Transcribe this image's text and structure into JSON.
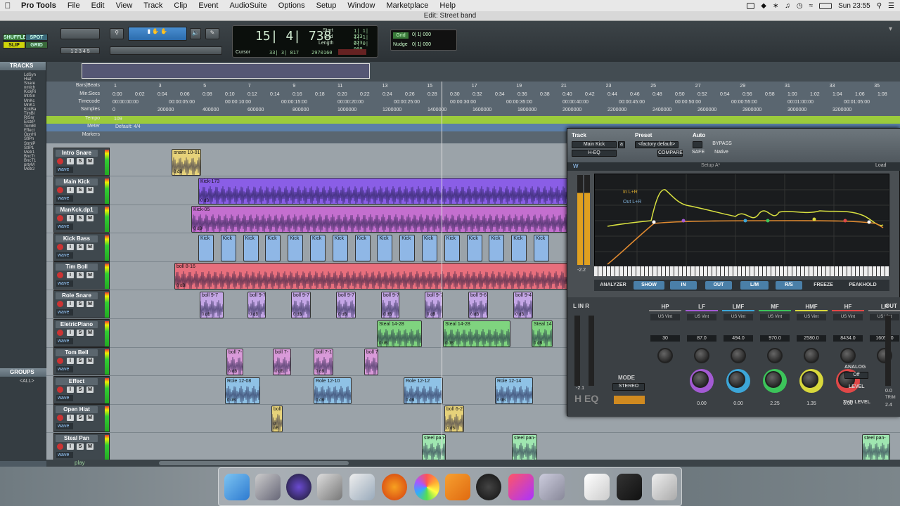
{
  "menubar": {
    "app": "Pro Tools",
    "items": [
      "File",
      "Edit",
      "View",
      "Track",
      "Clip",
      "Event",
      "AudioSuite",
      "Options",
      "Setup",
      "Window",
      "Marketplace",
      "Help"
    ],
    "clock": "Sun 23:55"
  },
  "window_title": "Edit: Street band",
  "toolbar": {
    "modes": [
      "SHUFFLE",
      "SPOT",
      "SLIP",
      "GRID"
    ],
    "counter": {
      "main": "15| 4| 738",
      "start_label": "Start",
      "end_label": "End",
      "length_label": "Length",
      "start": "1| 1| 223",
      "end": "1| 1| 223",
      "length": "0| 0| 000",
      "cursor_label": "Cursor",
      "cursor": "33| 3| 817",
      "samples": "2970160"
    },
    "grid_label": "Grid",
    "grid_value": "0| 1| 000",
    "nudge_label": "Nudge",
    "nudge_value": "0| 1| 000"
  },
  "tracks_panel": {
    "title": "TRACKS",
    "items": [
      "LdSyn",
      "Hiat",
      "Snare",
      "nmich",
      "KickRi",
      "IntrSn",
      "MnKc",
      "MnK1",
      "KckBa",
      "TimBl",
      "RlSnr",
      "ElctrP",
      "TomBl",
      "Effect",
      "OpnHi",
      "StlPn",
      "StrnlP",
      "StlP1",
      "Metr1",
      "BncTr",
      "BncT1",
      "prtyM",
      "Metr2"
    ]
  },
  "groups_panel": {
    "title": "GROUPS",
    "all": "<ALL>"
  },
  "rulers": {
    "labels": [
      "Bars|Beats",
      "Min:Secs",
      "Timecode",
      "Samples",
      "Tempo",
      "Meter",
      "Markers"
    ],
    "bars": [
      "1",
      "3",
      "5",
      "7",
      "9",
      "11",
      "13",
      "15",
      "17",
      "19",
      "21",
      "23",
      "25",
      "27",
      "29",
      "31",
      "33",
      "35"
    ],
    "minsecs": [
      "0:00",
      "0:02",
      "0:04",
      "0:06",
      "0:08",
      "0:10",
      "0:12",
      "0:14",
      "0:16",
      "0:18",
      "0:20",
      "0:22",
      "0:24",
      "0:26",
      "0:28",
      "0:30",
      "0:32",
      "0:34",
      "0:36",
      "0:38",
      "0:40",
      "0:42",
      "0:44",
      "0:46",
      "0:48",
      "0:50",
      "0:52",
      "0:54",
      "0:56",
      "0:58",
      "1:00",
      "1:02",
      "1:04",
      "1:06",
      "1:08",
      "1:10",
      "1:12",
      "1:14"
    ],
    "timecode": [
      "00:00:00:00",
      "00:00:05:00",
      "00:00:10:00",
      "00:00:15:00",
      "00:00:20:00",
      "00:00:25:00",
      "00:00:30:00",
      "00:00:35:00",
      "00:00:40:00",
      "00:00:45:00",
      "00:00:50:00",
      "00:00:55:00",
      "00:01:00:00",
      "00:01:05:00",
      "00:01:10:00",
      "00:01:15:00"
    ],
    "samples": [
      "0",
      "200000",
      "400000",
      "600000",
      "800000",
      "1000000",
      "1200000",
      "1400000",
      "1600000",
      "1800000",
      "2000000",
      "2200000",
      "2400000",
      "2600000",
      "2800000",
      "3000000",
      "3200000"
    ],
    "tempo": "109",
    "meter": "Default: 4/4"
  },
  "tracks": [
    {
      "name": "Intro Snare",
      "clips": [
        {
          "label": "snare 10-01",
          "db": "0 dB"
        }
      ],
      "color": "#e6d27a"
    },
    {
      "name": "Main Kick",
      "clips": [
        {
          "label": "Kick-173",
          "db": "0 dB"
        }
      ],
      "color": "#8a5ee6"
    },
    {
      "name": "ManKck.dp1",
      "clips": [
        {
          "label": "Kick-05",
          "db": "0 dB"
        }
      ],
      "color": "#c46fcf"
    },
    {
      "name": "Kick Bass",
      "clips": [
        {
          "label": "Kick",
          "db": ""
        }
      ],
      "color": "#8fb7e6"
    },
    {
      "name": "Tim Boll",
      "clips": [
        {
          "label": "boll 8-16",
          "db": "0 dB"
        }
      ],
      "color": "#e86f7d"
    },
    {
      "name": "Role Snare",
      "clips": [
        {
          "label": "boll 9-7",
          "db": "0 dB"
        },
        {
          "label": "boll 9-7",
          "db": "0 dB"
        },
        {
          "label": "boll 9-7",
          "db": "0 dB"
        },
        {
          "label": "boll 9-7",
          "db": "0 dB"
        },
        {
          "label": "boll 9-7",
          "db": "0 dB"
        },
        {
          "label": "boll 9-7",
          "db": "0 dB"
        },
        {
          "label": "boll 9-6",
          "db": "0 dB"
        },
        {
          "label": "boll 9-4",
          "db": "0 dB"
        }
      ],
      "color": "#c4a6e6"
    },
    {
      "name": "EletricPiano",
      "clips": [
        {
          "label": "Steal 14-28",
          "db": "0 dB"
        },
        {
          "label": "Steal 14-28",
          "db": "0 dB"
        },
        {
          "label": "Steal 14",
          "db": "0 dB"
        }
      ],
      "color": "#7fd47f"
    },
    {
      "name": "Tom Bell",
      "clips": [
        {
          "label": "boll 7-",
          "db": "0 dB"
        },
        {
          "label": "boll 7-",
          "db": "0 dB"
        },
        {
          "label": "boll 7-1",
          "db": "0 dB"
        },
        {
          "label": "boll 7",
          "db": ""
        }
      ],
      "color": "#d99ad9"
    },
    {
      "name": "Effect",
      "clips": [
        {
          "label": "Role 12-08",
          "db": "0 dB"
        },
        {
          "label": "Role 12-10",
          "db": "0 dB"
        },
        {
          "label": "Role 12-12",
          "db": "0 dB"
        },
        {
          "label": "Role 12-14",
          "db": "0 dB"
        }
      ],
      "color": "#8fc2e6"
    },
    {
      "name": "Open Hiat",
      "clips": [
        {
          "label": "boll",
          "db": "0 dB"
        },
        {
          "label": "boll 6-2",
          "db": "0 dB"
        }
      ],
      "color": "#e6d27a"
    },
    {
      "name": "Steal Pan",
      "clips": [
        {
          "label": "steel pan-",
          "db": ""
        },
        {
          "label": "steel pan-",
          "db": ""
        },
        {
          "label": "steel pan-",
          "db": ""
        }
      ],
      "color": "#9fe6b0"
    }
  ],
  "track_buttons": {
    "solo": "S",
    "mute": "M",
    "wave": "wave"
  },
  "bottom_label": "play",
  "plugin": {
    "track_label": "Track",
    "preset_label": "Preset",
    "auto_label": "Auto",
    "track_name": "Main Kick",
    "insert": "a",
    "plugin_name": "H-EQ",
    "preset": "<factory default>",
    "compare": "COMPARE",
    "bypass": "BYPASS",
    "safe": "SAFE",
    "native": "Native",
    "setup": "Setup A*",
    "load": "Load",
    "graph_in": "In L+R",
    "graph_out": "Out L+R",
    "analyzer": "ANALYZER",
    "show": "SHOW",
    "in": "IN",
    "out": "OUT",
    "lr": "L/M",
    "rs": "R/S",
    "freeze": "FREEZE",
    "peakhold": "PEAKHOLD",
    "bands": [
      {
        "name": "HP",
        "type": "US Vint",
        "freq": "30",
        "gain": "",
        "accent": "#888"
      },
      {
        "name": "LF",
        "type": "US Vint",
        "freq": "87.0",
        "gain": "0.00",
        "accent": "#a35ad3"
      },
      {
        "name": "LMF",
        "type": "US Vint",
        "freq": "494.0",
        "gain": "0.00",
        "accent": "#3ca6d8"
      },
      {
        "name": "MF",
        "type": "US Vint",
        "freq": "970.0",
        "gain": "2.25",
        "accent": "#3cc45a"
      },
      {
        "name": "HMF",
        "type": "US Vint",
        "freq": "2580.0",
        "gain": "1.35",
        "accent": "#d8d83c"
      },
      {
        "name": "HF",
        "type": "US Vint",
        "freq": "8434.0",
        "gain": "0.00",
        "accent": "#e04848"
      },
      {
        "name": "LP",
        "type": "US Vint",
        "freq": "16056.0",
        "gain": "",
        "accent": "#888"
      }
    ],
    "mode_label": "MODE",
    "mode_value": "STEREO",
    "logo": "H EQ",
    "analog": "ANALOG",
    "analog_value": "Off",
    "level": "LEVEL",
    "thd": "THD LEVEL",
    "in_label": "L IN R",
    "out_label": "OUT",
    "in_meter_vals": "-2.1",
    "out_meter_val": "0.0",
    "trim": "TRIM",
    "trim_val": "2.4",
    "meter_side_val": "-2.2"
  }
}
